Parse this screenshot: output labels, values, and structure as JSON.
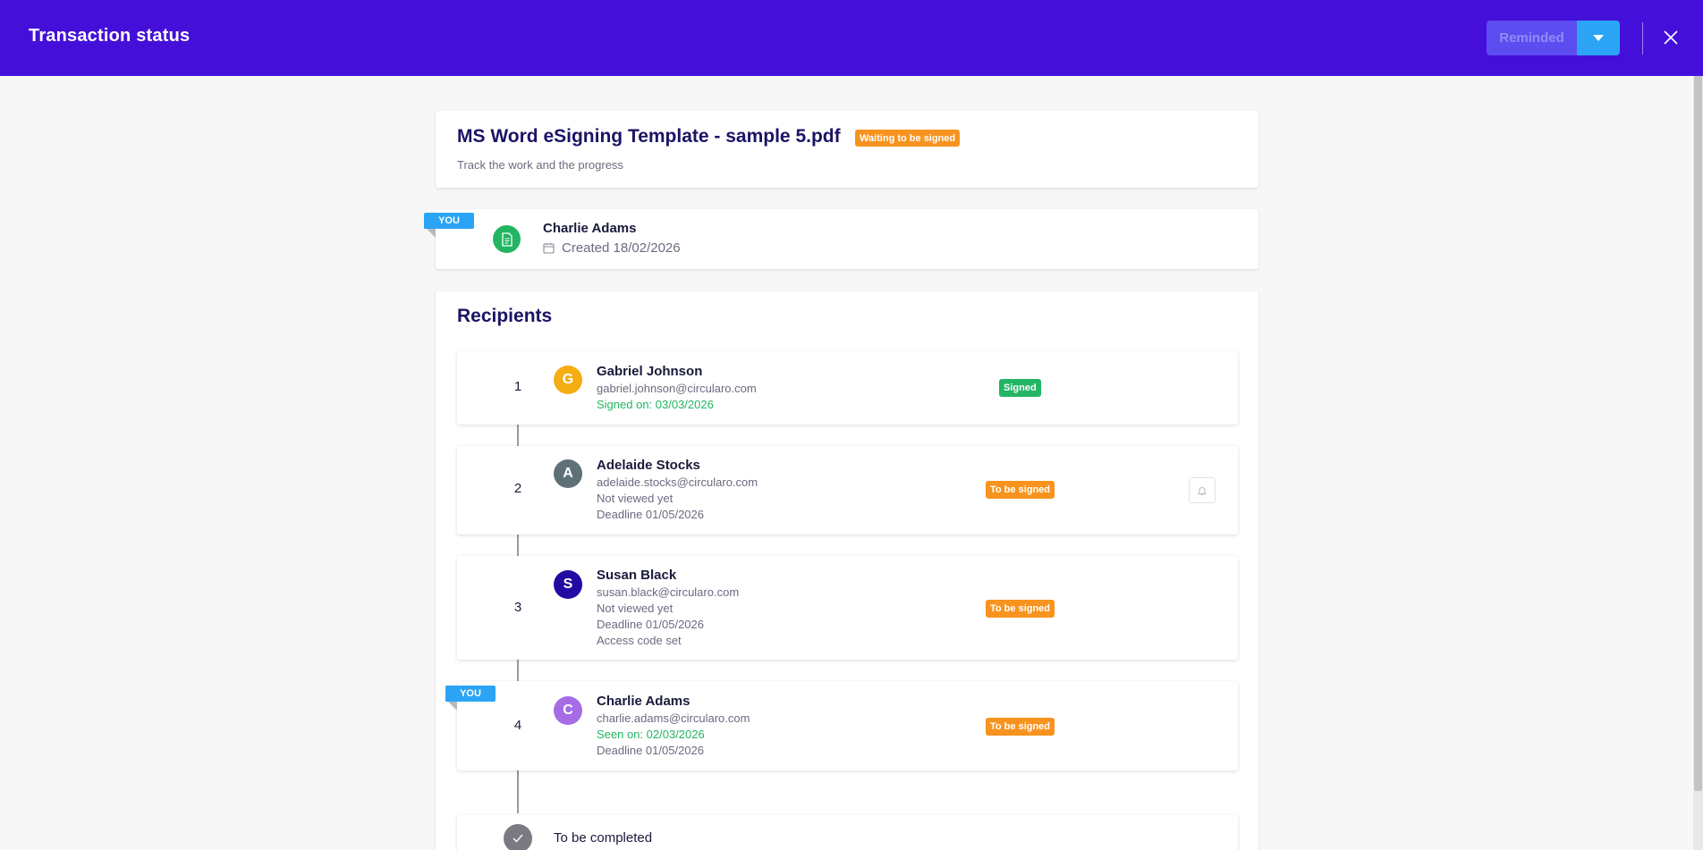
{
  "header": {
    "title": "Transaction status",
    "reminded_label": "Reminded",
    "dropdown_icon": "caret-down-icon",
    "close_icon": "close-icon"
  },
  "document": {
    "title": "MS Word eSigning Template - sample 5.pdf",
    "status": "Waiting to be signed",
    "subtitle": "Track the work and the progress"
  },
  "creator": {
    "you_label": "YOU",
    "name": "Charlie Adams",
    "created": "Created 18/02/2026",
    "icon": "document-icon"
  },
  "recipients": {
    "heading": "Recipients",
    "items": [
      {
        "number": "1",
        "initial": "G",
        "name": "Gabriel Johnson",
        "email": "gabriel.johnson@circularo.com",
        "line1": "Signed on: 03/03/2026",
        "status": "Signed"
      },
      {
        "number": "2",
        "initial": "A",
        "name": "Adelaide Stocks",
        "email": "adelaide.stocks@circularo.com",
        "line1": "Not viewed yet",
        "line2": "Deadline 01/05/2026",
        "status": "To be signed"
      },
      {
        "number": "3",
        "initial": "S",
        "name": "Susan Black",
        "email": "susan.black@circularo.com",
        "line1": "Not viewed yet",
        "line2": "Deadline 01/05/2026",
        "line3": "Access code set",
        "status": "To be signed"
      },
      {
        "number": "4",
        "you_label": "YOU",
        "initial": "C",
        "name": "Charlie Adams",
        "email": "charlie.adams@circularo.com",
        "line1": "Seen on: 02/03/2026",
        "line2": "Deadline 01/05/2026",
        "status": "To be signed"
      }
    ],
    "completion_label": "To be completed"
  },
  "colors": {
    "header_bg": "#4410d9",
    "accent_blue": "#2ba4f5",
    "status_orange": "#f7931e",
    "status_green": "#22b563",
    "avatar_g": "#f5ad14",
    "avatar_a": "#5f7078",
    "avatar_s": "#230aa3",
    "avatar_c": "#a56ce6"
  }
}
